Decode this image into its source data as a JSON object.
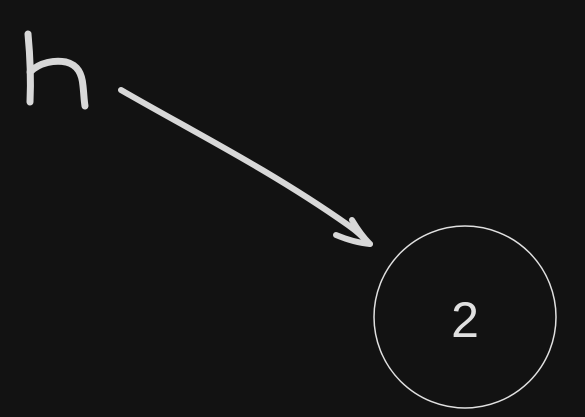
{
  "diagram": {
    "pointer_label": "h",
    "node": {
      "value": "2"
    },
    "colors": {
      "background": "#121212",
      "stroke": "#d8d8d8"
    }
  }
}
